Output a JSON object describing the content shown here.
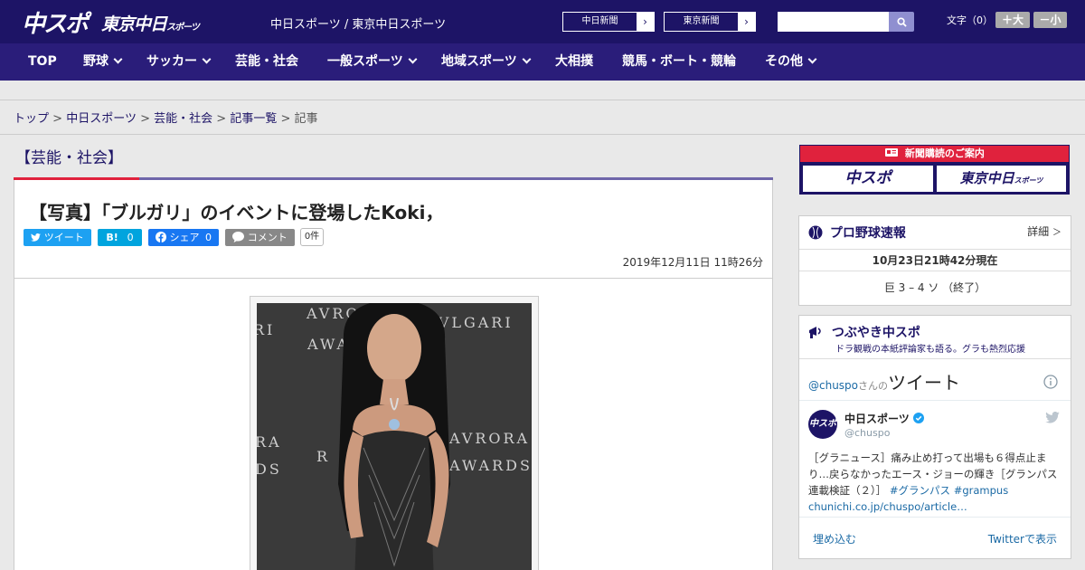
{
  "header": {
    "logo_main": "中スポ",
    "logo_sub": "東京中日",
    "logo_sub_small": "スポーツ",
    "site_title": "中日スポーツ / 東京中日スポーツ",
    "paper_links": [
      {
        "label": "中日新聞",
        "arrow": "›"
      },
      {
        "label": "東京新聞",
        "arrow": "›"
      }
    ],
    "search": {
      "value": "",
      "placeholder": ""
    },
    "font_size_label": "文字（0）",
    "font_up": "＋大",
    "font_down": "－小"
  },
  "nav": {
    "items": [
      {
        "label": "TOP",
        "dropdown": false
      },
      {
        "label": "野球",
        "dropdown": true
      },
      {
        "label": "サッカー",
        "dropdown": true
      },
      {
        "label": "芸能・社会",
        "dropdown": false
      },
      {
        "label": "一般スポーツ",
        "dropdown": true
      },
      {
        "label": "地域スポーツ",
        "dropdown": true
      },
      {
        "label": "大相撲",
        "dropdown": false
      },
      {
        "label": "競馬・ボート・競輪",
        "dropdown": false
      },
      {
        "label": "その他",
        "dropdown": true
      }
    ]
  },
  "breadcrumb": {
    "items": [
      "トップ",
      "中日スポーツ",
      "芸能・社会",
      "記事一覧"
    ],
    "current": "記事",
    "separator": ">"
  },
  "category": {
    "heading": "【芸能・社会】"
  },
  "article": {
    "title": "【写真】「ブルガリ」のイベントに登場したKoki，",
    "share": {
      "tweet": "ツイート",
      "hatena": "B!",
      "hatena_count": "0",
      "facebook": "シェア",
      "facebook_count": "0",
      "comment": "コメント",
      "comment_count": "0件"
    },
    "date": "2019年12月11日 11時26分",
    "photo_wall_text": [
      "AVRORA",
      "BVLGARI",
      "AWARDS",
      "RI",
      "AVRORA",
      "AWARDS",
      "RA",
      "DS",
      "R"
    ]
  },
  "sidebar": {
    "subscription": {
      "title": "新聞購読のご案内",
      "left": "中スポ",
      "right": "東京中日",
      "right_small": "スポーツ"
    },
    "baseball": {
      "title": "プロ野球速報",
      "detail": "詳細",
      "detail_arrow": "＞",
      "timestamp": "10月23日21時42分現在",
      "score": "巨 3 – 4 ソ （終了）"
    },
    "tweets": {
      "title": "つぶやき中スポ",
      "subtitle": "ドラ観戦の本紙評論家も語る。グラも熱烈応援",
      "handle_prefix": "@chuspo",
      "handle_mid": "さんの",
      "handle_suffix": "ツイート",
      "account_name": "中日スポーツ",
      "account_handle": "@chuspo",
      "avatar_text": "中スポ",
      "tweet_text": "［グラニュース］痛み止め打って出場も６得点止まり…戻らなかったエース・ジョーの輝き［グランパス連載検証（２）］",
      "hashtag1": "#グランパス",
      "hashtag2": "#grampus",
      "link": "chunichi.co.jp/chuspo/article…",
      "embed": "埋め込む",
      "view_on": "Twitterで表示"
    }
  },
  "colors": {
    "header_bg": "#1d1466",
    "nav_bg": "#2a1d7a",
    "accent_red": "#e0223d",
    "twitter": "#1da1f2",
    "hatena": "#00a4de",
    "facebook": "#1877f2",
    "link": "#1b6aa5"
  }
}
